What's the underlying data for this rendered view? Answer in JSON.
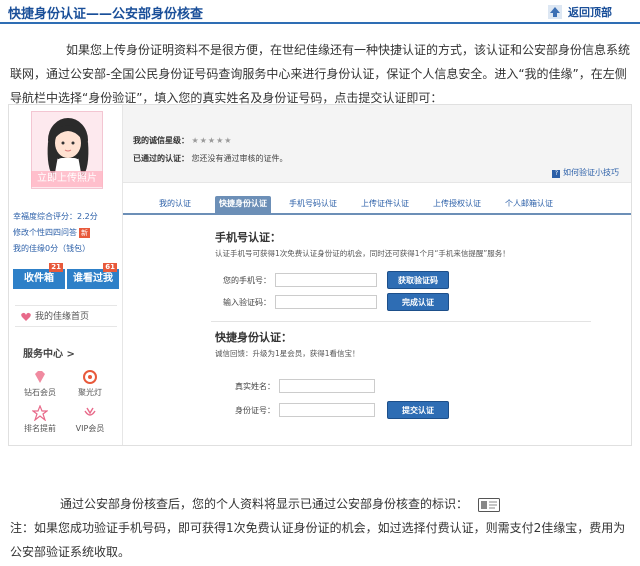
{
  "header": {
    "title": "快捷身份认证——公安部身份核查",
    "back_top": "返回顶部"
  },
  "intro": "如果您上传身份证明资料不是很方便，在世纪佳缘还有一种快捷认证的方式，该认证和公安部身份信息系统联网，通过公安部-全国公民身份证号码查询服务中心来进行身份认证，保证个人信息安全。进入“我的佳缘”，在左侧导航栏中选择“身份验证”，填入您的真实姓名及身份证号码，点击提交认证即可：",
  "sidebar": {
    "upload_photo": "立即上传照片",
    "score": "幸福度综合评分：2.2分",
    "edit_profile": "修改个性四四问答",
    "my_coins": "我的佳缘0分（钱包）",
    "new_tag": "新",
    "inbox": "收件箱",
    "inbox_count": "21",
    "who_viewed": "谁看过我",
    "viewed_count": "61",
    "home": "我的佳缘首页",
    "service_center": "服务中心",
    "services": [
      {
        "label": "钻石会员",
        "icon": "diamond-icon"
      },
      {
        "label": "聚光灯",
        "icon": "spotlight-icon"
      },
      {
        "label": "排名提前",
        "icon": "rank-icon"
      },
      {
        "label": "VIP会员",
        "icon": "vip-icon"
      }
    ]
  },
  "main": {
    "credit_label": "我的诚信星级：",
    "credit_stars": "★★★★★",
    "passed_label": "已通过的认证：",
    "passed_value": "您还没有通过审核的证件。",
    "how_link": "如何验证小技巧",
    "tabs": [
      {
        "label": "我的认证",
        "active": false
      },
      {
        "label": "快捷身份认证",
        "active": true
      },
      {
        "label": "手机号码认证",
        "active": false
      },
      {
        "label": "上传证件认证",
        "active": false
      },
      {
        "label": "上传授权认证",
        "active": false
      },
      {
        "label": "个人邮箱认证",
        "active": false
      }
    ],
    "phone_section": {
      "title": "手机号认证：",
      "desc": "认证手机号可获得1次免费认证身份证的机会，同时还可获得1个月“手机来信提醒”服务！",
      "phone_label": "您的手机号：",
      "code_label": "输入验证码：",
      "get_code_button": "获取验证码",
      "finish_button": "完成认证"
    },
    "id_section": {
      "title": "快捷身份认证：",
      "desc": "诚信回馈：升级为1星会员，获得1看信宝！",
      "name_label": "真实姓名：",
      "id_label": "身份证号：",
      "submit_button": "提交认证"
    }
  },
  "after_text": "通过公安部身份核查后，您的个人资料将显示已通过公安部身份核查的标识：",
  "note": "注：如果您成功验证手机号码，即可获得1次免费认证身份证的机会，如过选择付费认证，则需支付2佳缘宝，费用为公安部验证系统收取。",
  "colors": {
    "brand_blue": "#1a4f99",
    "button_blue": "#2e6db4",
    "tab_blue": "#6c8fb7",
    "badge_red": "#e8593b"
  }
}
